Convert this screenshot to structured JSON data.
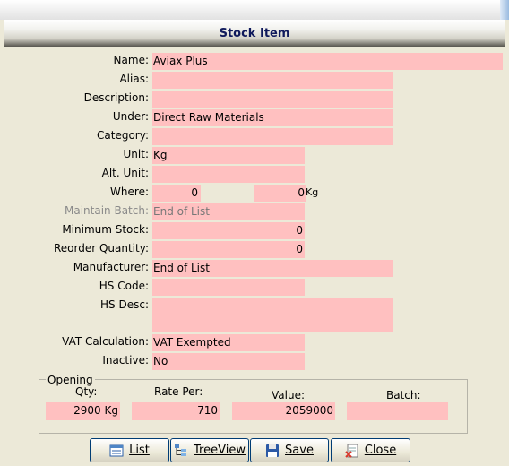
{
  "window": {
    "title": "Stock Item"
  },
  "fields": {
    "name": {
      "label": "Name:",
      "value": "Aviax Plus"
    },
    "alias": {
      "label": "Alias:",
      "value": ""
    },
    "description": {
      "label": "Description:",
      "value": ""
    },
    "under": {
      "label": "Under:",
      "value": "Direct Raw Materials"
    },
    "category": {
      "label": "Category:",
      "value": ""
    },
    "unit": {
      "label": "Unit:",
      "value": "Kg"
    },
    "alt_unit": {
      "label": "Alt. Unit:",
      "value": ""
    },
    "where": {
      "label": "Where:",
      "value1": "0",
      "value2": "0",
      "unit": "Kg"
    },
    "maintain_batch": {
      "label": "Maintain Batch:",
      "value": "End of List"
    },
    "minimum_stock": {
      "label": "Minimum Stock:",
      "value": "0"
    },
    "reorder_quantity": {
      "label": "Reorder Quantity:",
      "value": "0"
    },
    "manufacturer": {
      "label": "Manufacturer:",
      "value": "End of List"
    },
    "hs_code": {
      "label": "HS Code:",
      "value": ""
    },
    "hs_desc": {
      "label": "HS Desc:",
      "value": ""
    },
    "vat_calculation": {
      "label": "VAT Calculation:",
      "value": "VAT Exempted"
    },
    "inactive": {
      "label": "Inactive:",
      "value": "No"
    }
  },
  "opening": {
    "legend": "Opening",
    "qty_label": "Qty:",
    "rate_label": "Rate Per:",
    "value_label": "Value:",
    "batch_label": "Batch:",
    "qty": "2900 Kg",
    "rate": "710",
    "value": "2059000",
    "batch": ""
  },
  "buttons": {
    "list": "List",
    "treeview": "TreeView",
    "save": "Save",
    "close": "Close"
  },
  "icons": {
    "list": "list-icon",
    "treeview": "tree-icon",
    "save": "floppy-disk-icon",
    "close": "close-document-icon"
  },
  "colors": {
    "field_bg": "#ffc0c0",
    "title_text": "#101a5c",
    "window_bg": "#ece9d8"
  }
}
